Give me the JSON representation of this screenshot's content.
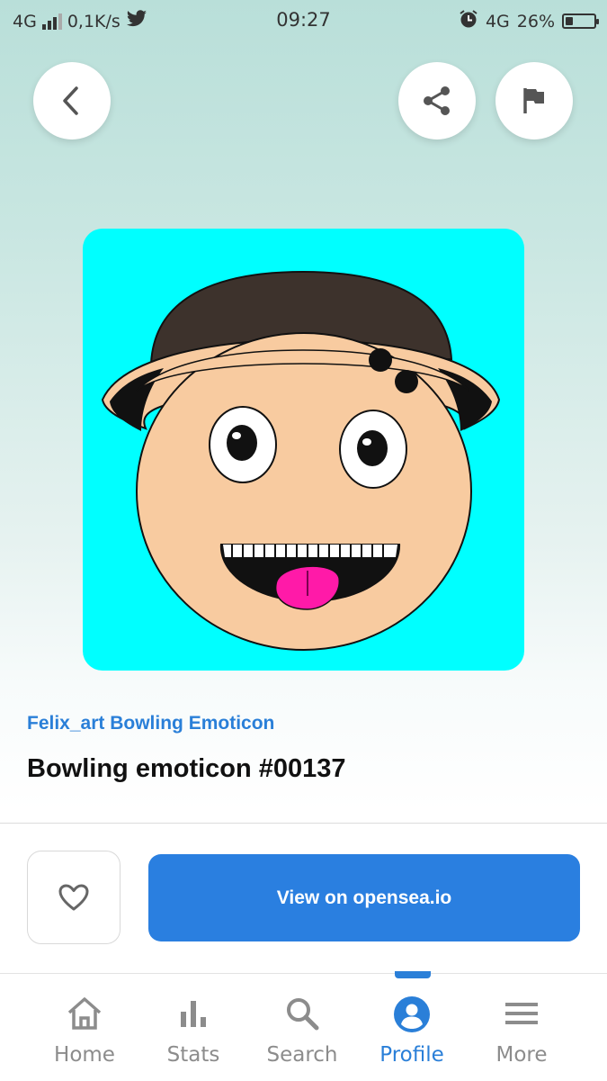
{
  "status_bar": {
    "network_left": "4G",
    "speed": "0,1K/s",
    "time": "09:27",
    "network_right": "4G",
    "battery": "26%",
    "battery_level": 0.26,
    "icons": [
      "signal-icon",
      "twitter-icon",
      "alarm-icon",
      "battery-icon"
    ]
  },
  "header": {
    "back_icon": "chevron-left-icon",
    "share_icon": "share-icon",
    "flag_icon": "flag-icon"
  },
  "artwork": {
    "background": "#00ffff",
    "description_icon": "emoticon-artwork"
  },
  "nft": {
    "collection": "Felix_art Bowling Emoticon",
    "title": "Bowling emoticon #00137"
  },
  "actions": {
    "like_icon": "heart-icon",
    "view_label": "View on opensea.io"
  },
  "bottom_nav": {
    "items": [
      {
        "label": "Home",
        "icon": "home-icon"
      },
      {
        "label": "Stats",
        "icon": "stats-icon"
      },
      {
        "label": "Search",
        "icon": "search-icon"
      },
      {
        "label": "Profile",
        "icon": "profile-icon",
        "active": true
      },
      {
        "label": "More",
        "icon": "menu-icon"
      }
    ]
  },
  "colors": {
    "accent": "#2a7fd8",
    "button": "#2a7fe0",
    "inactive": "#8c8c8c"
  }
}
